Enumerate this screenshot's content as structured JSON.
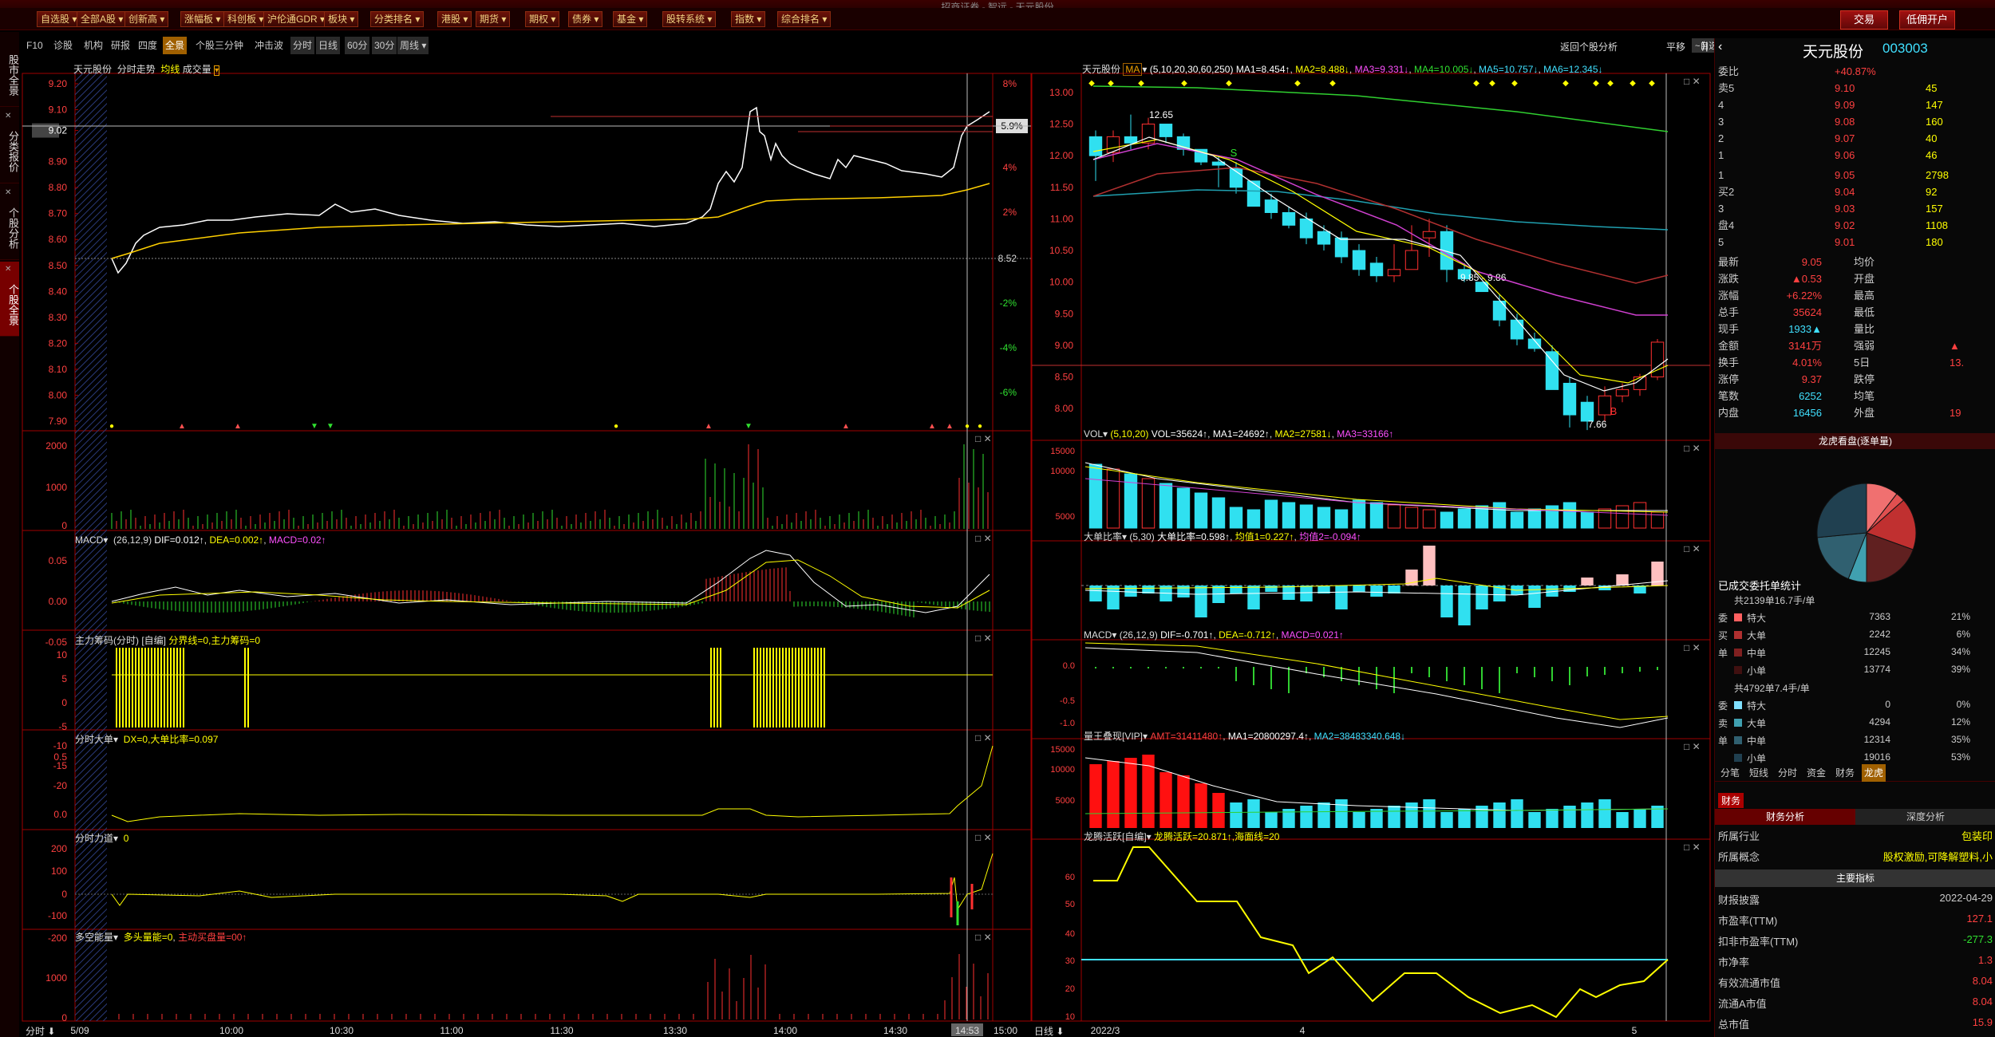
{
  "window": {
    "title": "招商证券 - 智远 - 天元股份"
  },
  "toolbar": {
    "items": [
      "自选股",
      "全部A股",
      "创新高",
      "涨幅板",
      "科创板",
      "沪伦通GDR",
      "板块",
      "分类排名",
      "港股",
      "期货",
      "期权",
      "债券",
      "基金",
      "股转系统",
      "指数",
      "综合排名"
    ],
    "trade": "交易",
    "open_account": "低佣开户"
  },
  "sidebar": {
    "tabs": [
      "股市全景",
      "分类报价",
      "个股分析",
      "个股全景"
    ]
  },
  "subtoolbar": {
    "items": [
      "F10",
      "诊股",
      "机构",
      "研报",
      "四度",
      "全景",
      "个股三分钟",
      "冲击波",
      "分时",
      "日线",
      "60分",
      "30分",
      "周线 ▾"
    ],
    "right": [
      "返回个股分析",
      "平移",
      "~自选 ▾"
    ]
  },
  "intraday": {
    "title": "天元股份",
    "subtitle": "分时走势",
    "legend_avg": "均线",
    "legend_vol": "成交量",
    "price_ticks": [
      "9.20",
      "9.10",
      "9.02",
      "8.90",
      "8.80",
      "8.70",
      "8.60",
      "8.50",
      "8.40",
      "8.30",
      "8.20",
      "8.10",
      "8.00",
      "7.90"
    ],
    "pct_ticks": [
      "8%",
      "6%",
      "4%",
      "2%",
      "-2%",
      "-4%",
      "-6%"
    ],
    "prev_close": "8.52",
    "current_pct": "5.9%",
    "time_ticks": [
      "5/09",
      "10:00",
      "10:30",
      "11:00",
      "11:30",
      "13:30",
      "14:00",
      "14:30",
      "14:53",
      "15:00"
    ],
    "time_label": "分时",
    "vol_ticks": [
      "2000",
      "1000",
      "0"
    ],
    "macd_title": "MACD",
    "macd_params": "(26,12,9)",
    "macd_dif": "DIF=0.012↑",
    "macd_dea": "DEA=0.002↑",
    "macd_val": "MACD=0.02↑",
    "macd_ticks": [
      "0.05",
      "0.00",
      "-0.05"
    ],
    "zlcm_title": "主力筹码(分时)",
    "zlcm_sub": "[自编]",
    "zlcm_val": "分界线=0,主力筹码=0",
    "zlcm_ticks": [
      "10",
      "5",
      "0",
      "-5",
      "-10",
      "-15",
      "-20"
    ],
    "fsdd_title": "分时大单",
    "fsdd_val": "DX=0,大单比率=0.097",
    "fsdd_ticks": [
      "0.5",
      "0.0"
    ],
    "fsld_title": "分时力道",
    "fsld_val": "0",
    "fsld_ticks": [
      "200",
      "100",
      "0",
      "-100",
      "-200"
    ],
    "dkn_title": "多空能量",
    "dkn_val": "多头量能=0",
    "dkn_val2": "主动买盘量=00↑",
    "dkn_ticks": [
      "1000",
      "0"
    ]
  },
  "kline": {
    "title": "天元股份",
    "ma_label": "MA",
    "ma_params": "(5,10,20,30,60,250)",
    "ma1": "MA1=8.454↑",
    "ma2": "MA2=8.488↓",
    "ma3": "MA3=9.331↓",
    "ma4": "MA4=10.005↓",
    "ma5": "MA5=10.757↓",
    "ma6": "MA6=12.345↓",
    "price_ticks": [
      "13.00",
      "12.50",
      "12.00",
      "11.50",
      "11.00",
      "10.50",
      "10.00",
      "9.50",
      "9.00",
      "8.50",
      "8.00"
    ],
    "high_label": "12.65",
    "low_label": "7.66",
    "mid_label": "9.85 - 9.86",
    "s_mark": "S",
    "b_mark": "B",
    "date_ticks": [
      "2022/3",
      "4",
      "5"
    ],
    "date_label": "日线",
    "vol_title": "VOL",
    "vol_params": "(5,10,20)",
    "vol_val": "VOL=35624↑",
    "vol_ma1": "MA1=24692↑",
    "vol_ma2": "MA2=27581↓",
    "vol_ma3": "MA3=33166↑",
    "vol_ticks": [
      "15000",
      "10000",
      "5000"
    ],
    "ddbl_title": "大单比率",
    "ddbl_params": "(5,30)",
    "ddbl_val": "大单比率=0.598↑",
    "ddbl_avg1": "均值1=0.227↑",
    "ddbl_avg2": "均值2=-0.094↑",
    "macd_title": "MACD",
    "macd_params": "(26,12,9)",
    "macd_dif": "DIF=-0.701↑",
    "macd_dea": "DEA=-0.712↑",
    "macd_val": "MACD=0.021↑",
    "macd_ticks": [
      "0.0",
      "-0.5",
      "-1.0"
    ],
    "lwsx_title": "量王叠现[VIP]",
    "lwsx_amt": "AMT=31411480↑",
    "lwsx_ma1": "MA1=20800297.4↑",
    "lwsx_ma2": "MA2=38483340.648↓",
    "lwsx_ticks": [
      "15000",
      "10000",
      "5000"
    ],
    "lths_title": "龙腾活跃[自编]",
    "lths_val": "龙腾活跃=20.871↑,海面线=20",
    "lths_ticks": [
      "60",
      "50",
      "40",
      "30",
      "20",
      "10"
    ]
  },
  "quote": {
    "name": "天元股份",
    "code": "003003",
    "weibi_label": "委比",
    "weibi": "+40.87%",
    "sell": [
      {
        "lbl": "卖5",
        "p": "9.10",
        "v": "45"
      },
      {
        "lbl": "4",
        "p": "9.09",
        "v": "147"
      },
      {
        "lbl": "3",
        "p": "9.08",
        "v": "160"
      },
      {
        "lbl": "2",
        "p": "9.07",
        "v": "40"
      },
      {
        "lbl": "1",
        "p": "9.06",
        "v": "46"
      }
    ],
    "buy": [
      {
        "lbl": "1",
        "p": "9.05",
        "v": "2798"
      },
      {
        "lbl": "买2",
        "p": "9.04",
        "v": "92"
      },
      {
        "lbl": "3",
        "p": "9.03",
        "v": "157"
      },
      {
        "lbl": "盘4",
        "p": "9.02",
        "v": "1108"
      },
      {
        "lbl": "5",
        "p": "9.01",
        "v": "180"
      }
    ],
    "stats": [
      {
        "l": "最新",
        "v": "9.05",
        "l2": "均价",
        "v2": ""
      },
      {
        "l": "涨跌",
        "v": "▲0.53",
        "l2": "开盘",
        "v2": ""
      },
      {
        "l": "涨幅",
        "v": "+6.22%",
        "l2": "最高",
        "v2": ""
      },
      {
        "l": "总手",
        "v": "35624",
        "l2": "最低",
        "v2": ""
      },
      {
        "l": "现手",
        "v": "1933▲",
        "l2": "量比",
        "v2": ""
      },
      {
        "l": "金额",
        "v": "3141万",
        "l2": "强弱",
        "v2": "▲"
      },
      {
        "l": "换手",
        "v": "4.01%",
        "l2": "5日",
        "v2": "13."
      },
      {
        "l": "涨停",
        "v": "9.37",
        "l2": "跌停",
        "v2": ""
      },
      {
        "l": "笔数",
        "v": "6252",
        "l2": "均笔",
        "v2": ""
      },
      {
        "l": "内盘",
        "v": "16456",
        "l2": "外盘",
        "v2": "19"
      }
    ],
    "pie_title": "龙虎看盘(逐单量)",
    "entrust_title": "已成交委托单统计",
    "g1_head": "共2139单16.7手/单",
    "g1": [
      {
        "s": "委",
        "n": "特大",
        "v": "7363",
        "p": "21%"
      },
      {
        "s": "买",
        "n": "大单",
        "v": "2242",
        "p": "6%"
      },
      {
        "s": "单",
        "n": "中单",
        "v": "12245",
        "p": "34%"
      },
      {
        "s": "",
        "n": "小单",
        "v": "13774",
        "p": "39%"
      }
    ],
    "g2_head": "共4792单7.4手/单",
    "g2": [
      {
        "s": "委",
        "n": "特大",
        "v": "0",
        "p": "0%"
      },
      {
        "s": "卖",
        "n": "大单",
        "v": "4294",
        "p": "12%"
      },
      {
        "s": "单",
        "n": "中单",
        "v": "12314",
        "p": "35%"
      },
      {
        "s": "",
        "n": "小单",
        "v": "19016",
        "p": "53%"
      }
    ],
    "tabs": [
      "分笔",
      "短线",
      "分时",
      "资金",
      "财务",
      "龙虎"
    ],
    "fin_tab": "财务",
    "fin_head": "财务分析",
    "fin_head2": "深度分析",
    "industry_l": "所属行业",
    "industry_v": "包装印",
    "concept_l": "所属概念",
    "concept_v": "股权激励,可降解塑料,小",
    "main_idx": "主要指标",
    "fin": [
      {
        "l": "财报披露",
        "v": "2022-04-29"
      },
      {
        "l": "市盈率(TTM)",
        "v": "127.1"
      },
      {
        "l": "扣非市盈率(TTM)",
        "v": "-277.3"
      },
      {
        "l": "市净率",
        "v": "1.3"
      },
      {
        "l": "有效流通市值",
        "v": "8.04"
      },
      {
        "l": "流通A市值",
        "v": "8.04"
      },
      {
        "l": "总市值",
        "v": "15.9"
      }
    ]
  }
}
